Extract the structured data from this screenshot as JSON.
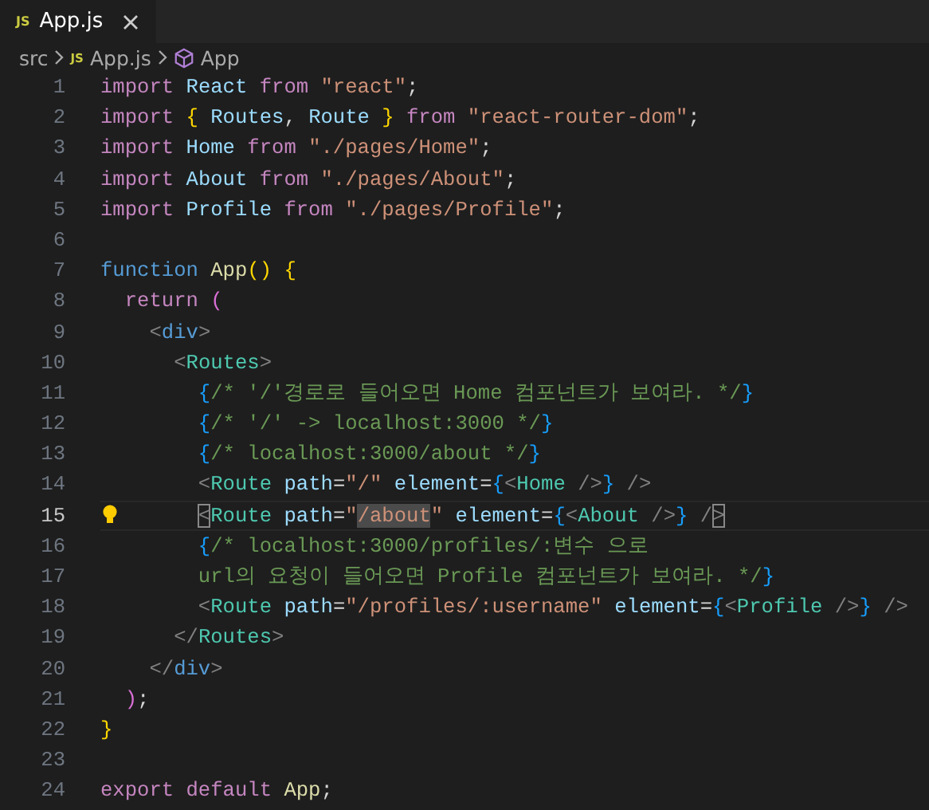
{
  "tabs": [
    {
      "icon_text": "JS",
      "label": "App.js",
      "selected": true
    }
  ],
  "breadcrumb": [
    {
      "kind": "folder",
      "label": "src"
    },
    {
      "kind": "file",
      "icon_text": "JS",
      "label": "App.js"
    },
    {
      "kind": "symbol",
      "label": "App"
    }
  ],
  "editor": {
    "lines": [
      {
        "number": "1",
        "tokens": [
          {
            "kind": "kw",
            "text": "import "
          },
          {
            "kind": "id",
            "text": "React "
          },
          {
            "kind": "kw",
            "text": "from "
          },
          {
            "kind": "str",
            "text": "\"react\""
          },
          {
            "kind": "plain",
            "text": ";"
          }
        ]
      },
      {
        "number": "2",
        "tokens": [
          {
            "kind": "kw",
            "text": "import "
          },
          {
            "kind": "b1",
            "text": "{ "
          },
          {
            "kind": "id",
            "text": "Routes"
          },
          {
            "kind": "plain",
            "text": ", "
          },
          {
            "kind": "id",
            "text": "Route "
          },
          {
            "kind": "b1",
            "text": "} "
          },
          {
            "kind": "kw",
            "text": "from "
          },
          {
            "kind": "str",
            "text": "\"react-router-dom\""
          },
          {
            "kind": "plain",
            "text": ";"
          }
        ]
      },
      {
        "number": "3",
        "tokens": [
          {
            "kind": "kw",
            "text": "import "
          },
          {
            "kind": "id",
            "text": "Home "
          },
          {
            "kind": "kw",
            "text": "from "
          },
          {
            "kind": "str",
            "text": "\"./pages/Home\""
          },
          {
            "kind": "plain",
            "text": ";"
          }
        ]
      },
      {
        "number": "4",
        "tokens": [
          {
            "kind": "kw",
            "text": "import "
          },
          {
            "kind": "id",
            "text": "About "
          },
          {
            "kind": "kw",
            "text": "from "
          },
          {
            "kind": "str",
            "text": "\"./pages/About\""
          },
          {
            "kind": "plain",
            "text": ";"
          }
        ]
      },
      {
        "number": "5",
        "tokens": [
          {
            "kind": "kw",
            "text": "import "
          },
          {
            "kind": "id",
            "text": "Profile "
          },
          {
            "kind": "kw",
            "text": "from "
          },
          {
            "kind": "str",
            "text": "\"./pages/Profile\""
          },
          {
            "kind": "plain",
            "text": ";"
          }
        ]
      },
      {
        "number": "6",
        "current": false
      },
      {
        "number": "7",
        "tokens": [
          {
            "kind": "storage",
            "text": "function "
          },
          {
            "kind": "fn",
            "text": "App"
          },
          {
            "kind": "b1",
            "text": "() {"
          }
        ]
      },
      {
        "number": "8",
        "tokens": [
          {
            "kind": "kw",
            "text": "  return "
          },
          {
            "kind": "b2",
            "text": "("
          }
        ]
      },
      {
        "number": "9",
        "tokens": [
          {
            "kind": "punc",
            "text": "    <"
          },
          {
            "kind": "htmltag",
            "text": "div"
          },
          {
            "kind": "punc",
            "text": ">"
          }
        ]
      },
      {
        "number": "10",
        "tokens": [
          {
            "kind": "punc",
            "text": "      <"
          },
          {
            "kind": "tag",
            "text": "Routes"
          },
          {
            "kind": "punc",
            "text": ">"
          }
        ]
      },
      {
        "number": "11",
        "tokens": [
          {
            "kind": "b3",
            "text": "        {"
          },
          {
            "kind": "comment",
            "text": "/* '/'경로로 들어오면 Home 컴포넌트가 보여라. */"
          },
          {
            "kind": "b3",
            "text": "}"
          }
        ]
      },
      {
        "number": "12",
        "tokens": [
          {
            "kind": "b3",
            "text": "        {"
          },
          {
            "kind": "comment",
            "text": "/* '/' -> localhost:3000 */"
          },
          {
            "kind": "b3",
            "text": "}"
          }
        ]
      },
      {
        "number": "13",
        "tokens": [
          {
            "kind": "b3",
            "text": "        {"
          },
          {
            "kind": "comment",
            "text": "/* localhost:3000/about */"
          },
          {
            "kind": "b3",
            "text": "}"
          }
        ]
      },
      {
        "number": "14",
        "tokens": [
          {
            "kind": "punc",
            "text": "        <"
          },
          {
            "kind": "tag",
            "text": "Route"
          },
          {
            "kind": "attr",
            "text": " path"
          },
          {
            "kind": "plain",
            "text": "="
          },
          {
            "kind": "str",
            "text": "\"/\""
          },
          {
            "kind": "attr",
            "text": " element"
          },
          {
            "kind": "plain",
            "text": "="
          },
          {
            "kind": "b3",
            "text": "{"
          },
          {
            "kind": "punc",
            "text": "<"
          },
          {
            "kind": "tag",
            "text": "Home"
          },
          {
            "kind": "punc",
            "text": " />"
          },
          {
            "kind": "b3",
            "text": "}"
          },
          {
            "kind": "punc",
            "text": " />"
          }
        ]
      },
      {
        "number": "15",
        "current": true,
        "tokens": [
          {
            "kind": "match",
            "text": "        <"
          },
          {
            "kind": "tag",
            "text": "Route"
          },
          {
            "kind": "attr",
            "text": " path"
          },
          {
            "kind": "plain",
            "text": "="
          },
          {
            "kind": "str",
            "text": "\""
          },
          {
            "kind": "found",
            "text": "/about"
          },
          {
            "kind": "str",
            "text": "\""
          },
          {
            "kind": "attr",
            "text": " element"
          },
          {
            "kind": "plain",
            "text": "="
          },
          {
            "kind": "b3",
            "text": "{"
          },
          {
            "kind": "punc",
            "text": "<"
          },
          {
            "kind": "tag",
            "text": "About"
          },
          {
            "kind": "punc",
            "text": " />"
          },
          {
            "kind": "b3",
            "text": "}"
          },
          {
            "kind": "punc",
            "text": " /"
          },
          {
            "kind": "match",
            "text": ">"
          }
        ]
      },
      {
        "number": "16",
        "tokens": [
          {
            "kind": "b3",
            "text": "        {"
          },
          {
            "kind": "comment",
            "text": "/* localhost:3000/profiles/:변수 으로"
          }
        ]
      },
      {
        "number": "17",
        "tokens": [
          {
            "kind": "comment",
            "text": "        url의 요청이 들어오면 Profile 컴포넌트가 보여라. */"
          },
          {
            "kind": "b3",
            "text": "}"
          }
        ]
      },
      {
        "number": "18",
        "tokens": [
          {
            "kind": "punc",
            "text": "        <"
          },
          {
            "kind": "tag",
            "text": "Route"
          },
          {
            "kind": "attr",
            "text": " path"
          },
          {
            "kind": "plain",
            "text": "="
          },
          {
            "kind": "str",
            "text": "\"/profiles/:username\""
          },
          {
            "kind": "attr",
            "text": " element"
          },
          {
            "kind": "plain",
            "text": "="
          },
          {
            "kind": "b3",
            "text": "{"
          },
          {
            "kind": "punc",
            "text": "<"
          },
          {
            "kind": "tag",
            "text": "Profile"
          },
          {
            "kind": "punc",
            "text": " />"
          },
          {
            "kind": "b3",
            "text": "}"
          },
          {
            "kind": "punc",
            "text": " />"
          }
        ]
      },
      {
        "number": "19",
        "tokens": [
          {
            "kind": "punc",
            "text": "      </"
          },
          {
            "kind": "tag",
            "text": "Routes"
          },
          {
            "kind": "punc",
            "text": ">"
          }
        ]
      },
      {
        "number": "20",
        "tokens": [
          {
            "kind": "punc",
            "text": "    </"
          },
          {
            "kind": "htmltag",
            "text": "div"
          },
          {
            "kind": "punc",
            "text": ">"
          }
        ]
      },
      {
        "number": "21",
        "tokens": [
          {
            "kind": "b2",
            "text": "  )"
          },
          {
            "kind": "plain",
            "text": ";"
          }
        ]
      },
      {
        "number": "22",
        "tokens": [
          {
            "kind": "b1",
            "text": "}"
          }
        ]
      },
      {
        "number": "23",
        "current": false
      },
      {
        "number": "24",
        "tokens": [
          {
            "kind": "kw",
            "text": "export default "
          },
          {
            "kind": "fn",
            "text": "App"
          },
          {
            "kind": "plain",
            "text": ";"
          }
        ]
      }
    ]
  }
}
